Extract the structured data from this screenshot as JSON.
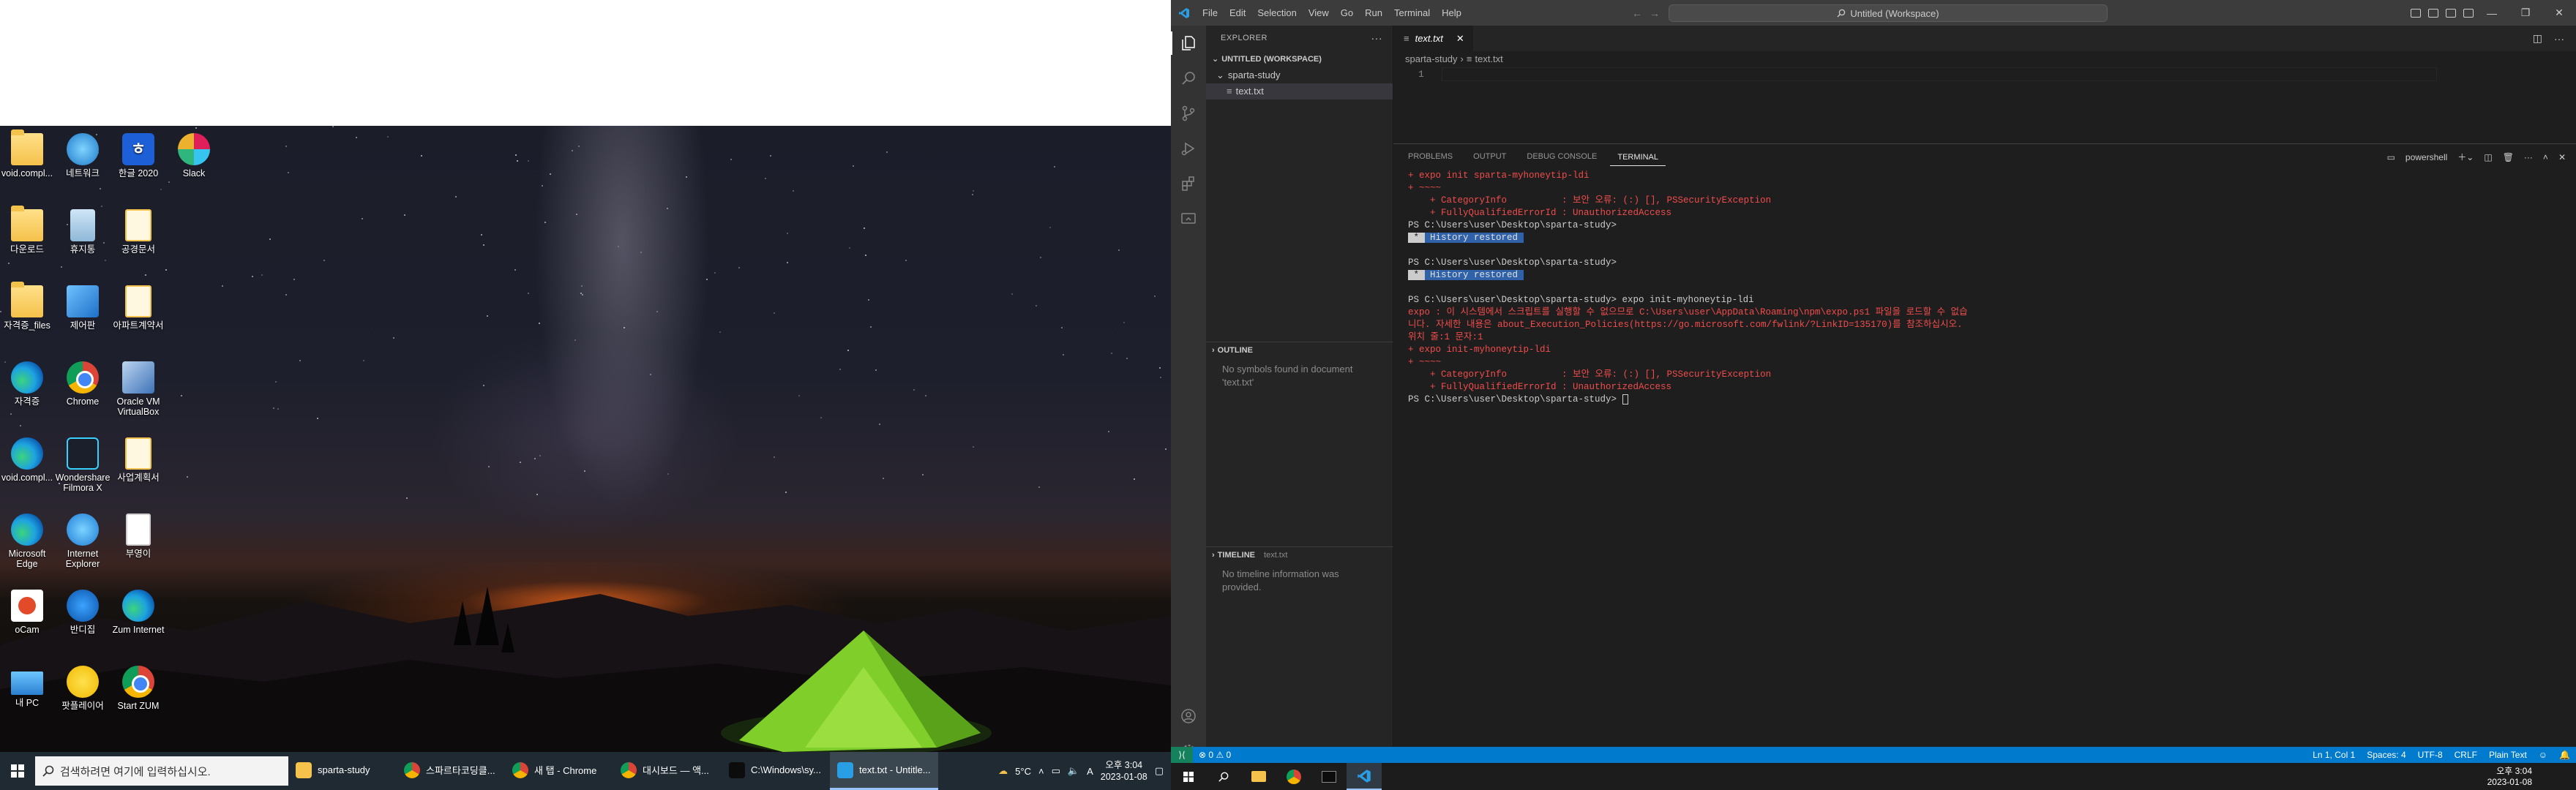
{
  "desktop": {
    "icons": [
      {
        "label": "void.compl...",
        "icon": "folder-icon"
      },
      {
        "label": "네트워크",
        "icon": "network-icon"
      },
      {
        "label": "한글 2020",
        "icon": "hangul-icon"
      },
      {
        "label": "Slack",
        "icon": "slack-icon"
      },
      {
        "label": "다운로드",
        "icon": "folder-icon"
      },
      {
        "label": "휴지통",
        "icon": "recycle-bin-icon"
      },
      {
        "label": "공경문서",
        "icon": "document-icon"
      },
      {
        "label": "자격증_files",
        "icon": "folder-icon"
      },
      {
        "label": "제어판",
        "icon": "control-panel-icon"
      },
      {
        "label": "아파트계약서",
        "icon": "document-icon"
      },
      {
        "label": "자격증",
        "icon": "edge-icon"
      },
      {
        "label": "Chrome",
        "icon": "chrome-icon"
      },
      {
        "label": "Oracle VM VirtualBox",
        "icon": "virtualbox-icon"
      },
      {
        "label": "void.compl...",
        "icon": "edge-icon"
      },
      {
        "label": "Wondershare Filmora X",
        "icon": "filmora-icon"
      },
      {
        "label": "사업계획서",
        "icon": "document-icon"
      },
      {
        "label": "Microsoft Edge",
        "icon": "edge-icon"
      },
      {
        "label": "Internet Explorer",
        "icon": "ie-icon"
      },
      {
        "label": "부영이",
        "icon": "hwp-icon"
      },
      {
        "label": "oCam",
        "icon": "ocam-icon"
      },
      {
        "label": "반디집",
        "icon": "bandizip-icon"
      },
      {
        "label": "Zum Internet",
        "icon": "zum-icon"
      },
      {
        "label": "내 PC",
        "icon": "pc-icon"
      },
      {
        "label": "팟플레이어",
        "icon": "potplayer-icon"
      },
      {
        "label": "Start ZUM",
        "icon": "chrome-icon"
      }
    ]
  },
  "win_taskbar": {
    "search_placeholder": "검색하려면 여기에 입력하십시오.",
    "apps": [
      {
        "label": "sparta-study",
        "icon": "folder-icon"
      },
      {
        "label": "스파르타코딩클...",
        "icon": "chrome-icon"
      },
      {
        "label": "새 탭 - Chrome",
        "icon": "chrome-icon"
      },
      {
        "label": "대시보드 — 액...",
        "icon": "chrome-icon"
      },
      {
        "label": "C:\\Windows\\sy...",
        "icon": "terminal-icon"
      },
      {
        "label": "text.txt - Untitle...",
        "icon": "vscode-icon"
      }
    ],
    "weather": "5°C",
    "ime": "A",
    "time": "오후 3:04",
    "date": "2023-01-08"
  },
  "vscode": {
    "menu": [
      "File",
      "Edit",
      "Selection",
      "View",
      "Go",
      "Run",
      "Terminal",
      "Help"
    ],
    "command_center": "Untitled (Workspace)",
    "explorer_title": "EXPLORER",
    "workspace_header": "UNTITLED (WORKSPACE)",
    "folder": "sparta-study",
    "file": "text.txt",
    "outline_header": "OUTLINE",
    "outline_empty": "No symbols found in document 'text.txt'",
    "timeline_header": "TIMELINE",
    "timeline_file": "text.txt",
    "timeline_empty": "No timeline information was provided.",
    "tab_label": "text.txt",
    "breadcrumb": [
      "sparta-study",
      "text.txt"
    ],
    "line_number": "1",
    "panel_tabs": [
      "PROBLEMS",
      "OUTPUT",
      "DEBUG CONSOLE",
      "TERMINAL"
    ],
    "terminal_shell": "powershell",
    "terminal_lines": [
      {
        "text": "+ expo init sparta-myhoneytip-ldi",
        "kind": "err"
      },
      {
        "text": "+ ~~~~",
        "kind": "err"
      },
      {
        "text": "    + CategoryInfo          : 보안 오류: (:) [], PSSecurityException",
        "kind": "err"
      },
      {
        "text": "    + FullyQualifiedErrorId : UnauthorizedAccess",
        "kind": "err"
      },
      {
        "text": "PS C:\\Users\\user\\Desktop\\sparta-study>",
        "kind": "plain"
      },
      {
        "text": " History restored ",
        "kind": "hl"
      },
      {
        "text": "",
        "kind": "plain"
      },
      {
        "text": "PS C:\\Users\\user\\Desktop\\sparta-study>",
        "kind": "plain"
      },
      {
        "text": " History restored ",
        "kind": "hl"
      },
      {
        "text": "",
        "kind": "plain"
      },
      {
        "text": "PS C:\\Users\\user\\Desktop\\sparta-study> expo init-myhoneytip-ldi",
        "kind": "plain"
      },
      {
        "text": "expo : 이 시스템에서 스크립트를 실행할 수 없으므로 C:\\Users\\user\\AppData\\Roaming\\npm\\expo.ps1 파일을 로드할 수 없습",
        "kind": "err"
      },
      {
        "text": "니다. 자세한 내용은 about_Execution_Policies(https://go.microsoft.com/fwlink/?LinkID=135170)를 참조하십시오.",
        "kind": "err"
      },
      {
        "text": "위치 줄:1 문자:1",
        "kind": "err"
      },
      {
        "text": "+ expo init-myhoneytip-ldi",
        "kind": "err"
      },
      {
        "text": "+ ~~~~",
        "kind": "err"
      },
      {
        "text": "    + CategoryInfo          : 보안 오류: (:) [], PSSecurityException",
        "kind": "err"
      },
      {
        "text": "    + FullyQualifiedErrorId : UnauthorizedAccess",
        "kind": "err"
      },
      {
        "text": "PS C:\\Users\\user\\Desktop\\sparta-study> ",
        "kind": "prompt"
      }
    ],
    "status": {
      "problems": "0",
      "warnings": "0",
      "position": "Ln 1, Col 1",
      "spaces": "Spaces: 4",
      "encoding": "UTF-8",
      "eol": "CRLF",
      "language": "Plain Text"
    },
    "taskbar_time": "오후 3:04",
    "taskbar_date": "2023-01-08"
  }
}
